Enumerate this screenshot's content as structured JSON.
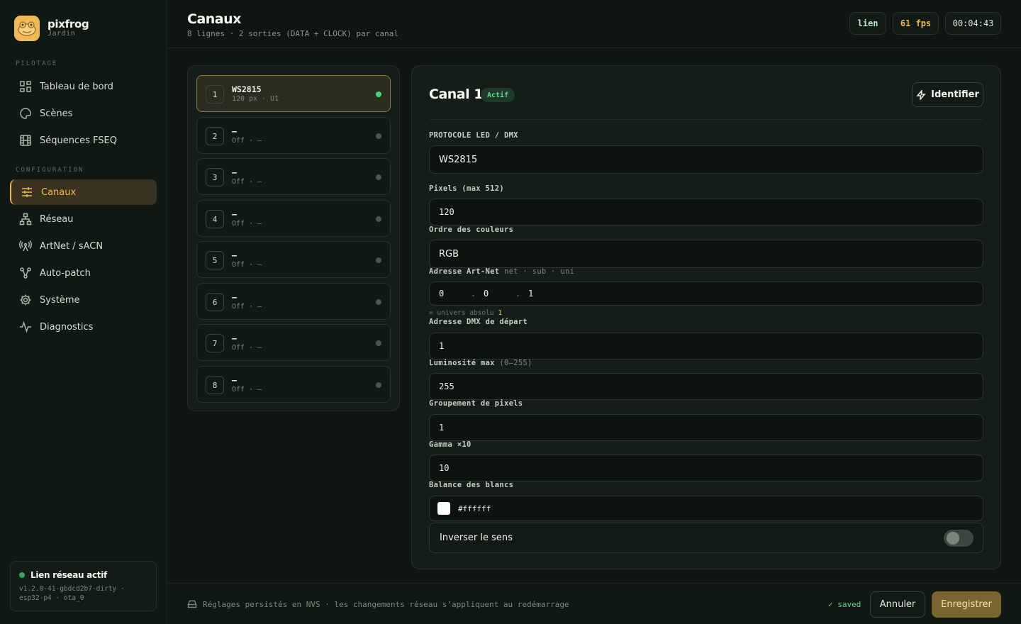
{
  "brand": {
    "name": "pixfrog",
    "sub": "Jardin"
  },
  "sidebar": {
    "section_pilotage": "PILOTAGE",
    "section_config": "CONFIGURATION",
    "items": [
      {
        "label": "Tableau de bord",
        "icon": "grid-icon"
      },
      {
        "label": "Scènes",
        "icon": "palette-icon"
      },
      {
        "label": "Séquences FSEQ",
        "icon": "film-icon"
      },
      {
        "label": "Canaux",
        "icon": "sliders-icon",
        "active": true
      },
      {
        "label": "Réseau",
        "icon": "network-icon"
      },
      {
        "label": "ArtNet / sACN",
        "icon": "antenna-icon"
      },
      {
        "label": "Auto-patch",
        "icon": "nodes-icon"
      },
      {
        "label": "Système",
        "icon": "gear-icon"
      },
      {
        "label": "Diagnostics",
        "icon": "pulse-icon"
      }
    ],
    "status": {
      "title": "Lien réseau actif",
      "line1": "v1.2.0-41-gbdcd2b7-dirty ·",
      "line2": "esp32-p4 · ota_0"
    }
  },
  "header": {
    "title": "Canaux",
    "subtitle": "8 lignes · 2 sorties (DATA + CLOCK) par canal",
    "pills": {
      "link": "lien",
      "fps": "61 fps",
      "clock": "00:04:43"
    }
  },
  "channels": [
    {
      "num": "1",
      "name": "WS2815",
      "meta": "120 px · U1"
    },
    {
      "num": "2",
      "name": "—",
      "meta": "Off · —"
    },
    {
      "num": "3",
      "name": "—",
      "meta": "Off · —"
    },
    {
      "num": "4",
      "name": "—",
      "meta": "Off · —"
    },
    {
      "num": "5",
      "name": "—",
      "meta": "Off · —"
    },
    {
      "num": "6",
      "name": "—",
      "meta": "Off · —"
    },
    {
      "num": "7",
      "name": "—",
      "meta": "Off · —"
    },
    {
      "num": "8",
      "name": "—",
      "meta": "Off · —"
    }
  ],
  "detail": {
    "title": "Canal 1",
    "badge": "Actif",
    "identify": "Identifier",
    "protocol_label": "PROTOCOLE LED / DMX",
    "protocol_value": "WS2815",
    "pixels_label": "Pixels (max 512)",
    "pixels_value": "120",
    "order_label": "Ordre des couleurs",
    "order_value": "RGB",
    "artnet_label": "Adresse Art-Net",
    "artnet_label_muted": "net · sub · uni",
    "artnet_net": "0",
    "artnet_sub": "0",
    "artnet_uni": "1",
    "artnet_sep": ".",
    "universe_hint": "= univers absolu",
    "universe_value": "1",
    "dmx_label": "Adresse DMX de départ",
    "dmx_value": "1",
    "brightness_label": "Luminosité max",
    "brightness_label_muted": "(0–255)",
    "brightness_value": "255",
    "grouping_label": "Groupement de pixels",
    "grouping_value": "1",
    "gamma_label": "Gamma ×10",
    "gamma_value": "10",
    "white_label": "Balance des blancs",
    "white_value": "#ffffff",
    "invert_label": "Inverser le sens"
  },
  "footer": {
    "note": "Réglages persistés en NVS · les changements réseau s’appliquent au redémarrage",
    "saved": "✓ saved",
    "cancel": "Annuler",
    "save": "Enregistrer"
  },
  "colors": {
    "accent": "#f0b955",
    "ok": "#47d07e",
    "bg": "#0f1612"
  }
}
